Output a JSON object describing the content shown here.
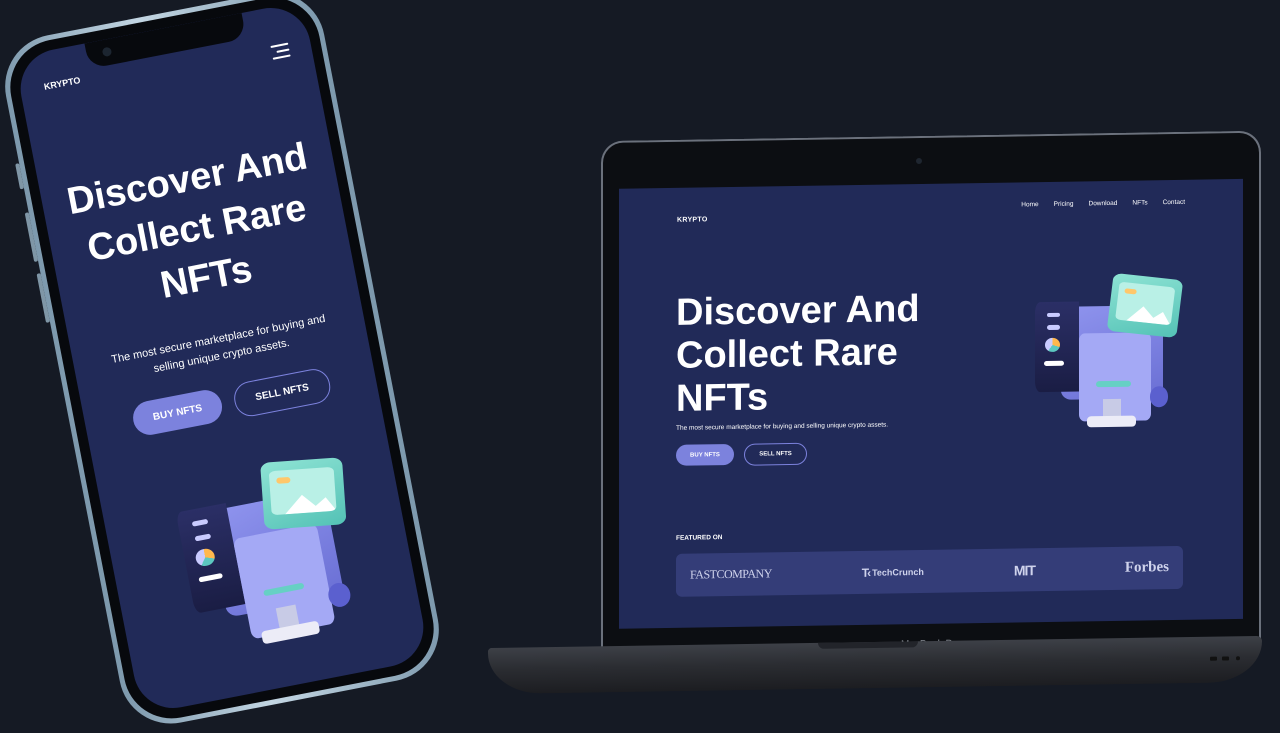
{
  "site": {
    "logo": "KRYPTO",
    "nav": [
      "Home",
      "Pricing",
      "Download",
      "NFTs",
      "Contact"
    ],
    "hero_title": "Discover And Collect Rare NFTs",
    "hero_subtitle": "The most secure marketplace for buying and selling unique crypto assets.",
    "buy_button": "BUY NFTS",
    "sell_button": "SELL NFTS",
    "featured_label": "FEATURED ON",
    "featured_logos": [
      "FASTCOMPANY",
      "TechCrunch",
      "MIT",
      "Forbes"
    ]
  },
  "laptop": {
    "model_label": "MacBook Pro"
  },
  "mobile": {
    "logo": "KRYPTO",
    "hero_title": "Discover And Collect Rare NFTs",
    "hero_subtitle": "The most secure marketplace for buying and selling unique crypto assets.",
    "buy_button": "BUY NFTS",
    "sell_button": "SELL NFTS",
    "menu_icon": "hamburger-menu-icon"
  },
  "colors": {
    "page_background": "#151a24",
    "site_background": "#212a58",
    "accent": "#7c82dd",
    "featured_bar": "#343d78"
  }
}
